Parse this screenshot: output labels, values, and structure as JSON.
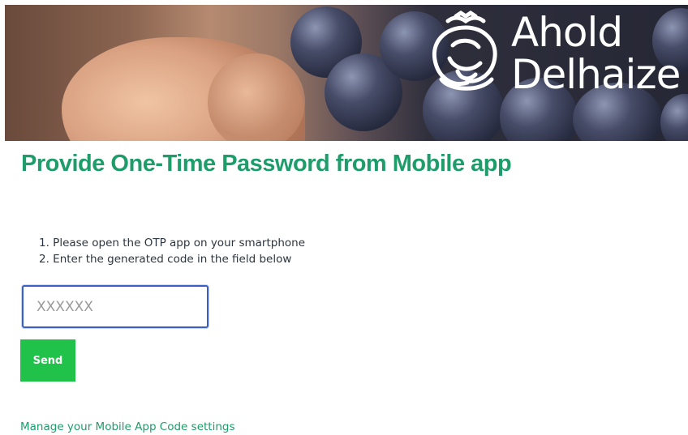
{
  "brand": {
    "logo_line1": "Ahold",
    "logo_line2": "Delhaize",
    "logo_icon": "lion-crown-icon"
  },
  "page_title": "Provide One-Time Password from Mobile app",
  "instructions": [
    "1. Please open the OTP app on your smartphone",
    "2. Enter the generated code in the field below"
  ],
  "otp_field": {
    "value": "",
    "placeholder": "XXXXXX"
  },
  "send_button": "Send",
  "manage_link": "Manage your Mobile App Code settings",
  "colors": {
    "title": "#1e9c6a",
    "button": "#21c249",
    "link": "#1e9c6a",
    "input_border": "#3a5fc6"
  }
}
